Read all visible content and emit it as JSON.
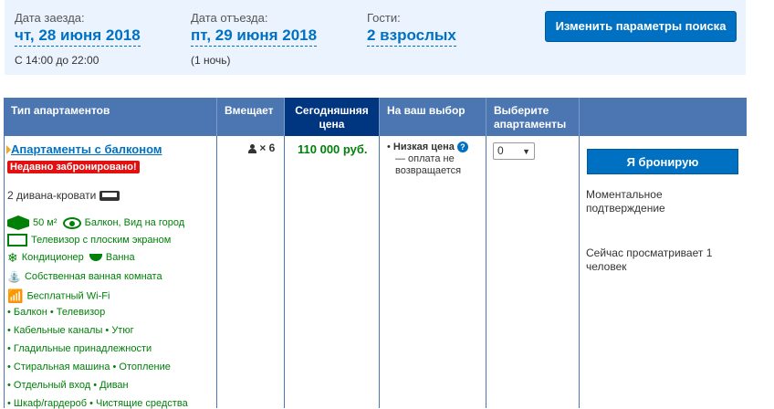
{
  "search": {
    "checkin_label": "Дата заезда:",
    "checkin_value": "чт, 28 июня 2018",
    "checkin_time": "С 14:00 до 22:00",
    "checkout_label": "Дата отъезда:",
    "checkout_value": "пт, 29 июня 2018",
    "checkout_nights": "(1 ночь)",
    "guests_label": "Гости:",
    "guests_value": "2 взрослых",
    "change_button": "Изменить параметры поиска"
  },
  "table": {
    "headers": [
      "Тип апартаментов",
      "Вмещает",
      "Сегодняшняя цена",
      "На ваш выбор",
      "Выберите апартаменты",
      ""
    ]
  },
  "room": {
    "name": "Апартаменты с балконом",
    "badge": "Недавно забронировано!",
    "beds": "2 дивана-кровати",
    "facilities": [
      "50 м²",
      "Балкон, Вид на город",
      "Телевизор с плоским экраном",
      "Кондиционер",
      "Ванна",
      "Собственная ванная комната",
      "Бесплатный Wi-Fi",
      "• Балкон  • Телевизор",
      "• Кабельные каналы  • Утюг",
      "• Гладильные принадлежности",
      "• Стиральная машина  • Отопление",
      "• Отдельный вход  • Диван",
      "• Шкаф/гардероб  • Чистящие средства"
    ],
    "guests_count": "× 6",
    "price": "110 000 руб.",
    "choice_title": "Низкая цена",
    "choice_text": "— оплата не возвращается",
    "select_value": "0",
    "book_button": "Я бронирую",
    "instant": "Моментальное подтверждение",
    "viewing": "Сейчас просматривает 1 человек"
  }
}
